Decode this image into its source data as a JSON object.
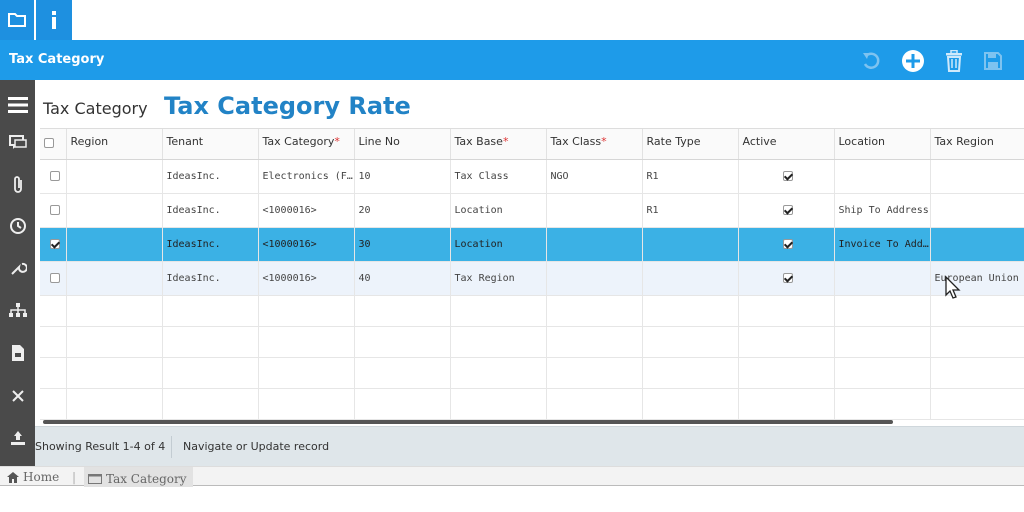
{
  "top_tabs": [
    {
      "name": "folder",
      "icon": "folder-icon"
    },
    {
      "name": "info",
      "icon": "info-icon"
    }
  ],
  "header": {
    "title": "Tax Category",
    "actions": [
      "undo-icon",
      "add-icon",
      "delete-icon",
      "save-icon"
    ],
    "color": "#1e9be9"
  },
  "sidebar": {
    "items": [
      "menu-icon",
      "chat-icon",
      "attachment-icon",
      "history-icon",
      "wrench-icon",
      "hierarchy-icon",
      "report-icon",
      "close-icon",
      "export-icon"
    ]
  },
  "main": {
    "breadcrumb_title": "Tax Category",
    "page_title": "Tax Category Rate"
  },
  "grid": {
    "columns": [
      {
        "label": "Region",
        "required": false
      },
      {
        "label": "Tenant",
        "required": false
      },
      {
        "label": "Tax Category",
        "required": true
      },
      {
        "label": "Line No",
        "required": false
      },
      {
        "label": "Tax Base",
        "required": true
      },
      {
        "label": "Tax Class",
        "required": true
      },
      {
        "label": "Rate Type",
        "required": false
      },
      {
        "label": "Active",
        "required": false
      },
      {
        "label": "Location",
        "required": false
      },
      {
        "label": "Tax Region",
        "required": false
      }
    ],
    "rows": [
      {
        "selected": false,
        "region": "",
        "tenant": "IdeasInc.",
        "tax_category": "Electronics (Fu...",
        "line_no": "10",
        "tax_base": "Tax Class",
        "tax_class": "NGO",
        "rate_type": "R1",
        "active": true,
        "location": "",
        "tax_region": ""
      },
      {
        "selected": false,
        "region": "",
        "tenant": "IdeasInc.",
        "tax_category": "<1000016>",
        "line_no": "20",
        "tax_base": "Location",
        "tax_class": "",
        "rate_type": "R1",
        "active": true,
        "location": "Ship To Address",
        "tax_region": ""
      },
      {
        "selected": true,
        "region": "",
        "tenant": "IdeasInc.",
        "tax_category": "<1000016>",
        "line_no": "30",
        "tax_base": "Location",
        "tax_class": "",
        "rate_type": "",
        "active": true,
        "location": "Invoice To Add...",
        "tax_region": ""
      },
      {
        "selected": false,
        "region": "",
        "tenant": "IdeasInc.",
        "tax_category": "<1000016>",
        "line_no": "40",
        "tax_base": "Tax Region",
        "tax_class": "",
        "rate_type": "",
        "active": true,
        "location": "",
        "tax_region": "European Union"
      }
    ]
  },
  "status": {
    "result": "Showing Result 1-4 of 4",
    "message": "Navigate or Update record"
  },
  "bottom_nav": {
    "home": "Home",
    "tab": "Tax Category"
  }
}
